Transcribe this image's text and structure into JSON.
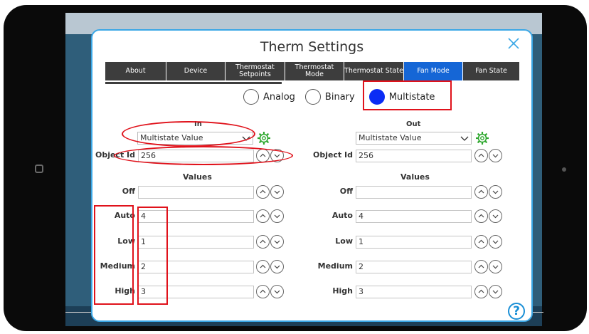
{
  "dialog": {
    "title": "Therm Settings"
  },
  "tabs": [
    {
      "label": "About",
      "active": false
    },
    {
      "label": "Device",
      "active": false
    },
    {
      "label": "Thermostat Setpoints",
      "active": false
    },
    {
      "label": "Thermostat Mode",
      "active": false
    },
    {
      "label": "Thermostat State",
      "active": false
    },
    {
      "label": "Fan Mode",
      "active": true
    },
    {
      "label": "Fan State",
      "active": false
    }
  ],
  "signal_type": {
    "options": [
      "Analog",
      "Binary",
      "Multistate"
    ],
    "selected": "Multistate"
  },
  "in": {
    "heading": "In",
    "object_type": "Multistate Value",
    "object_id_label": "Object Id",
    "object_id": "256",
    "values_heading": "Values",
    "values": [
      {
        "label": "Off",
        "value": ""
      },
      {
        "label": "Auto",
        "value": "4"
      },
      {
        "label": "Low",
        "value": "1"
      },
      {
        "label": "Medium",
        "value": "2"
      },
      {
        "label": "High",
        "value": "3"
      }
    ]
  },
  "out": {
    "heading": "Out",
    "object_type": "Multistate Value",
    "object_id_label": "Object Id",
    "object_id": "256",
    "values_heading": "Values",
    "values": [
      {
        "label": "Off",
        "value": ""
      },
      {
        "label": "Auto",
        "value": "4"
      },
      {
        "label": "Low",
        "value": "1"
      },
      {
        "label": "Medium",
        "value": "2"
      },
      {
        "label": "High",
        "value": "3"
      }
    ]
  },
  "help": {
    "label": "?"
  },
  "colors": {
    "active_tab": "#1566d6",
    "tab": "#3d3d3d",
    "radio_selected": "#0a2cf5",
    "gear": "#2ea82e",
    "dialog_border": "#3aa7e6",
    "annotation": "#e0121b"
  }
}
